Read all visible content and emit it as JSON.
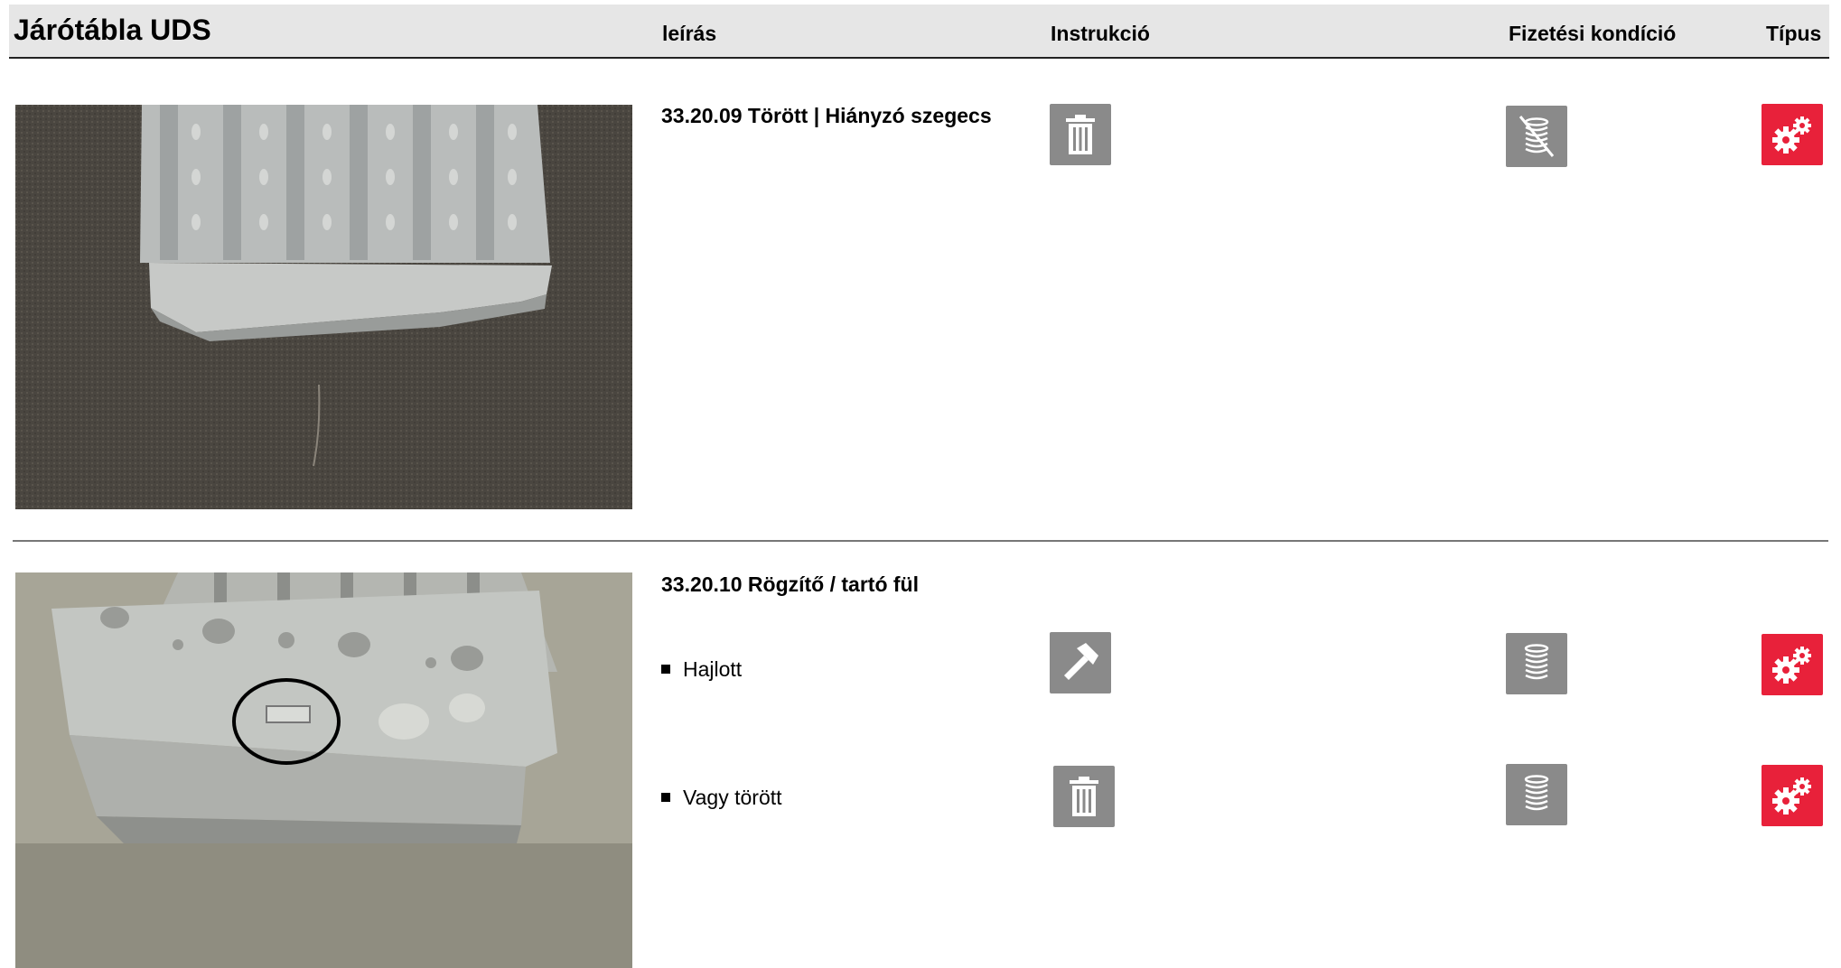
{
  "header": {
    "title": "Járótábla UDS",
    "col_description": "leírás",
    "col_instruction": "Instrukció",
    "col_payment": "Fizetési kondíció",
    "col_type": "Típus"
  },
  "sections": [
    {
      "code_title": "33.20.09 Törött | Hiányzó szegecs",
      "instruction_icon": "trash-icon",
      "payment_icon": "coins-crossed-icon",
      "type_icon": "gears-icon"
    },
    {
      "code_title": "33.20.10 Rögzítő / tartó fül",
      "items": [
        {
          "label": "Hajlott",
          "instruction_icon": "hammer-icon",
          "payment_icon": "coins-icon",
          "type_icon": "gears-icon"
        },
        {
          "label": "Vagy törött",
          "instruction_icon": "trash-icon",
          "payment_icon": "coins-icon",
          "type_icon": "gears-icon"
        }
      ]
    }
  ],
  "colors": {
    "icon_gray": "#8a8a8a",
    "icon_red": "#e8213a",
    "header_bg": "#e6e6e6"
  }
}
